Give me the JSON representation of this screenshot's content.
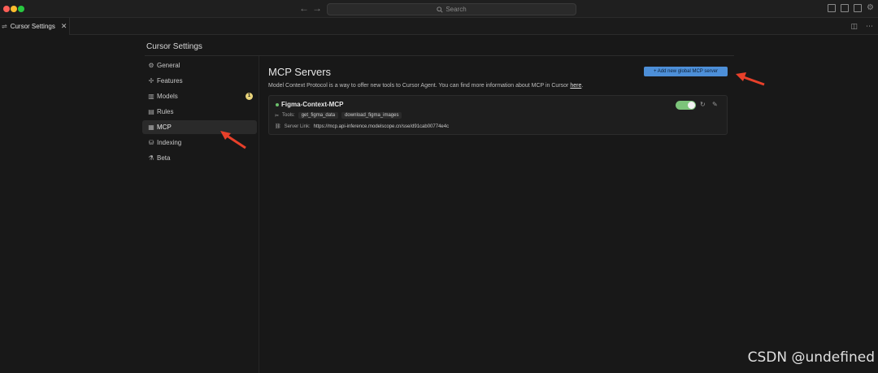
{
  "titlebar": {
    "search_placeholder": "Search"
  },
  "tab": {
    "label": "Cursor Settings",
    "close": "✕"
  },
  "settings": {
    "title": "Cursor Settings",
    "nav": [
      {
        "label": "General",
        "icon": "gear-icon",
        "glyph": "⚙"
      },
      {
        "label": "Features",
        "icon": "features-icon",
        "glyph": "✢"
      },
      {
        "label": "Models",
        "icon": "chart-icon",
        "glyph": "▥",
        "badge": "1"
      },
      {
        "label": "Rules",
        "icon": "document-icon",
        "glyph": "▤"
      },
      {
        "label": "MCP",
        "icon": "mcp-icon",
        "glyph": "▦",
        "active": true
      },
      {
        "label": "Indexing",
        "icon": "database-icon",
        "glyph": "⛁"
      },
      {
        "label": "Beta",
        "icon": "flask-icon",
        "glyph": "⚗"
      }
    ]
  },
  "mcp": {
    "title": "MCP Servers",
    "add_button": "+ Add new global MCP server",
    "description": "Model Context Protocol is a way to offer new tools to Cursor Agent. You can find more information about MCP in Cursor ",
    "description_link": "here",
    "description_end": ".",
    "servers": [
      {
        "name": "Figma-Context-MCP",
        "enabled": true,
        "tools_label": "Tools:",
        "tools": [
          "get_figma_data",
          "download_figma_images"
        ],
        "link_label": "Server Link:",
        "link": "https://mcp.api-inference.modelscope.cn/sse/d91cab00774e4c"
      }
    ]
  },
  "watermark": "CSDN @undefined",
  "colors": {
    "accent": "#4d8fd8",
    "toggle_on": "#7cc47a",
    "annotation_arrow": "#e8402a",
    "badge": "#e8d37a"
  }
}
